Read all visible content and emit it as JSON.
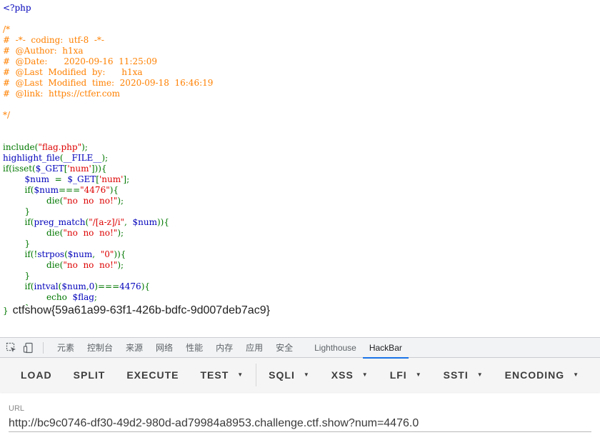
{
  "code": {
    "lines": [
      [
        {
          "t": "<?php",
          "c": "default"
        }
      ],
      [],
      [
        {
          "t": "/*",
          "c": "comment"
        }
      ],
      [
        {
          "t": "#  -*-  coding:  utf-8  -*-",
          "c": "comment"
        }
      ],
      [
        {
          "t": "#  @Author:  h1xa",
          "c": "comment"
        }
      ],
      [
        {
          "t": "#  @Date:      2020-09-16  11:25:09",
          "c": "comment"
        }
      ],
      [
        {
          "t": "#  @Last  Modified  by:      h1xa",
          "c": "comment"
        }
      ],
      [
        {
          "t": "#  @Last  Modified  time:  2020-09-18  16:46:19",
          "c": "comment"
        }
      ],
      [
        {
          "t": "#  @link:  https://ctfer.com",
          "c": "comment"
        }
      ],
      [],
      [
        {
          "t": "*/",
          "c": "comment"
        }
      ],
      [],
      [],
      [
        {
          "t": "include(",
          "c": "keyword"
        },
        {
          "t": "\"flag.php\"",
          "c": "string"
        },
        {
          "t": ");",
          "c": "keyword"
        }
      ],
      [
        {
          "t": "highlight_file",
          "c": "default"
        },
        {
          "t": "(",
          "c": "keyword"
        },
        {
          "t": "__FILE__",
          "c": "default"
        },
        {
          "t": ");",
          "c": "keyword"
        }
      ],
      [
        {
          "t": "if(isset(",
          "c": "keyword"
        },
        {
          "t": "$_GET",
          "c": "default"
        },
        {
          "t": "[",
          "c": "keyword"
        },
        {
          "t": "'num'",
          "c": "string"
        },
        {
          "t": "])){",
          "c": "keyword"
        }
      ],
      [
        {
          "t": "        ",
          "c": "html"
        },
        {
          "t": "$num  ",
          "c": "default"
        },
        {
          "t": "=  ",
          "c": "keyword"
        },
        {
          "t": "$_GET",
          "c": "default"
        },
        {
          "t": "[",
          "c": "keyword"
        },
        {
          "t": "'num'",
          "c": "string"
        },
        {
          "t": "];",
          "c": "keyword"
        }
      ],
      [
        {
          "t": "        ",
          "c": "html"
        },
        {
          "t": "if(",
          "c": "keyword"
        },
        {
          "t": "$num",
          "c": "default"
        },
        {
          "t": "===",
          "c": "keyword"
        },
        {
          "t": "\"4476\"",
          "c": "string"
        },
        {
          "t": "){",
          "c": "keyword"
        }
      ],
      [
        {
          "t": "                ",
          "c": "html"
        },
        {
          "t": "die(",
          "c": "keyword"
        },
        {
          "t": "\"no  no  no!\"",
          "c": "string"
        },
        {
          "t": ");",
          "c": "keyword"
        }
      ],
      [
        {
          "t": "        }",
          "c": "keyword"
        }
      ],
      [
        {
          "t": "        ",
          "c": "html"
        },
        {
          "t": "if(",
          "c": "keyword"
        },
        {
          "t": "preg_match",
          "c": "default"
        },
        {
          "t": "(",
          "c": "keyword"
        },
        {
          "t": "\"/[a-z]/i\"",
          "c": "string"
        },
        {
          "t": ",  ",
          "c": "keyword"
        },
        {
          "t": "$num",
          "c": "default"
        },
        {
          "t": ")){",
          "c": "keyword"
        }
      ],
      [
        {
          "t": "                ",
          "c": "html"
        },
        {
          "t": "die(",
          "c": "keyword"
        },
        {
          "t": "\"no  no  no!\"",
          "c": "string"
        },
        {
          "t": ");",
          "c": "keyword"
        }
      ],
      [
        {
          "t": "        }",
          "c": "keyword"
        }
      ],
      [
        {
          "t": "        ",
          "c": "html"
        },
        {
          "t": "if(!",
          "c": "keyword"
        },
        {
          "t": "strpos",
          "c": "default"
        },
        {
          "t": "(",
          "c": "keyword"
        },
        {
          "t": "$num",
          "c": "default"
        },
        {
          "t": ",  ",
          "c": "keyword"
        },
        {
          "t": "\"0\"",
          "c": "string"
        },
        {
          "t": ")){",
          "c": "keyword"
        }
      ],
      [
        {
          "t": "                ",
          "c": "html"
        },
        {
          "t": "die(",
          "c": "keyword"
        },
        {
          "t": "\"no  no  no!\"",
          "c": "string"
        },
        {
          "t": ");",
          "c": "keyword"
        }
      ],
      [
        {
          "t": "        }",
          "c": "keyword"
        }
      ],
      [
        {
          "t": "        ",
          "c": "html"
        },
        {
          "t": "if(",
          "c": "keyword"
        },
        {
          "t": "intval",
          "c": "default"
        },
        {
          "t": "(",
          "c": "keyword"
        },
        {
          "t": "$num",
          "c": "default"
        },
        {
          "t": ",",
          "c": "keyword"
        },
        {
          "t": "0",
          "c": "default"
        },
        {
          "t": ")===",
          "c": "keyword"
        },
        {
          "t": "4476",
          "c": "default"
        },
        {
          "t": "){",
          "c": "keyword"
        }
      ],
      [
        {
          "t": "                ",
          "c": "html"
        },
        {
          "t": "echo  ",
          "c": "keyword"
        },
        {
          "t": "$flag",
          "c": "default"
        },
        {
          "t": ";",
          "c": "keyword"
        }
      ],
      [
        {
          "t": "        }",
          "c": "keyword"
        }
      ]
    ],
    "closing_brace": "}",
    "flag_output": "ctfshow{59a61a99-63f1-426b-bdfc-9d007deb7ac9}"
  },
  "devtools": {
    "tabs": [
      {
        "label": "元素",
        "name": "tab-elements"
      },
      {
        "label": "控制台",
        "name": "tab-console"
      },
      {
        "label": "来源",
        "name": "tab-sources"
      },
      {
        "label": "网络",
        "name": "tab-network"
      },
      {
        "label": "性能",
        "name": "tab-performance"
      },
      {
        "label": "内存",
        "name": "tab-memory"
      },
      {
        "label": "应用",
        "name": "tab-application"
      },
      {
        "label": "安全",
        "name": "tab-security"
      },
      {
        "label": "Lighthouse",
        "name": "tab-lighthouse"
      },
      {
        "label": "HackBar",
        "name": "tab-hackbar"
      }
    ],
    "active_tab": "HackBar",
    "accent_color": "#1a73e8",
    "icons": [
      "element-picker-icon",
      "device-toolbar-icon"
    ]
  },
  "hackbar": {
    "buttons": [
      {
        "label": "LOAD",
        "name": "load-button",
        "caret": false
      },
      {
        "label": "SPLIT",
        "name": "split-button",
        "caret": false
      },
      {
        "label": "EXECUTE",
        "name": "execute-button",
        "caret": false
      },
      {
        "label": "TEST",
        "name": "test-menu",
        "caret": true
      }
    ],
    "menus": [
      {
        "label": "SQLI",
        "name": "sqli-menu",
        "caret": true
      },
      {
        "label": "XSS",
        "name": "xss-menu",
        "caret": true
      },
      {
        "label": "LFI",
        "name": "lfi-menu",
        "caret": true
      },
      {
        "label": "SSTI",
        "name": "ssti-menu",
        "caret": true
      },
      {
        "label": "ENCODING",
        "name": "encoding-menu",
        "caret": true
      }
    ],
    "url_label": "URL",
    "url_value": "http://bc9c0746-df30-49d2-980d-ad79984a8953.challenge.ctf.show?num=4476.0"
  },
  "colors": {
    "php_default": "#0000BB",
    "php_comment": "#FF8000",
    "php_keyword": "#007700",
    "php_string": "#DD0000"
  }
}
